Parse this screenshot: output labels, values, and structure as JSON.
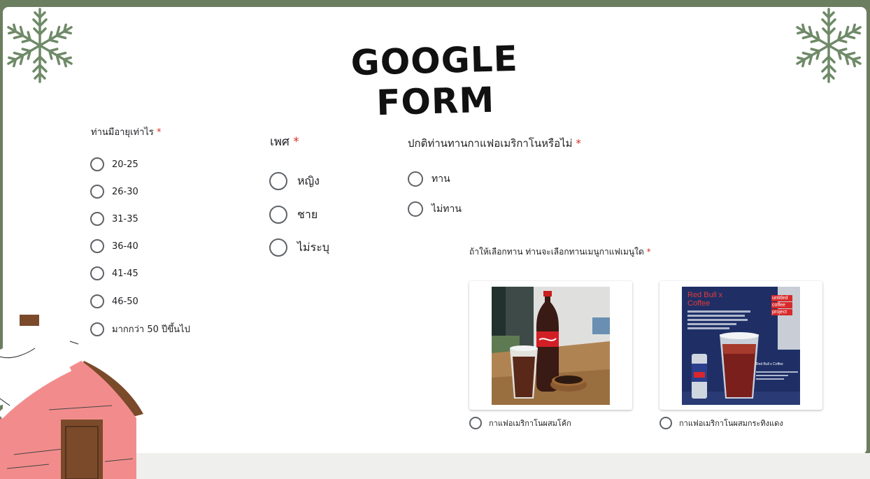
{
  "form_title": "GOOGLE FORM",
  "colors": {
    "frame": "#6b7e5f",
    "radio_border": "#5f6368",
    "required": "#d93025"
  },
  "q_age": {
    "label": "ท่านมีอายุเท่าไร",
    "required_mark": "*",
    "options": [
      "20-25",
      "26-30",
      "31-35",
      "36-40",
      "41-45",
      "46-50",
      "มากกว่า 50 ปีขึ้นไป"
    ]
  },
  "q_gender": {
    "label": "เพศ",
    "required_mark": "*",
    "options": [
      "หญิง",
      "ชาย",
      "ไม่ระบุ"
    ]
  },
  "q_drink": {
    "label": "ปกติท่านทานกาแฟอเมริกาโนหรือไม่",
    "required_mark": "*",
    "options": [
      "ทาน",
      "ไม่ทาน"
    ]
  },
  "q_menu": {
    "label": "ถ้าให้เลือกทาน ท่านจะเลือกทานเมนูกาแฟเมนูใด",
    "required_mark": "*",
    "options": [
      "กาแฟอเมริกาโนผสมโค้ก",
      "กาแฟอเมริกาโนผสมกระทิงแดง"
    ],
    "poster": {
      "title_line1": "Red Bull x",
      "title_line2": "Coffee",
      "brand_line1": "untitled",
      "brand_line2": "coffee",
      "brand_line3": "project",
      "caption": "Red Bull x Coffee"
    }
  }
}
